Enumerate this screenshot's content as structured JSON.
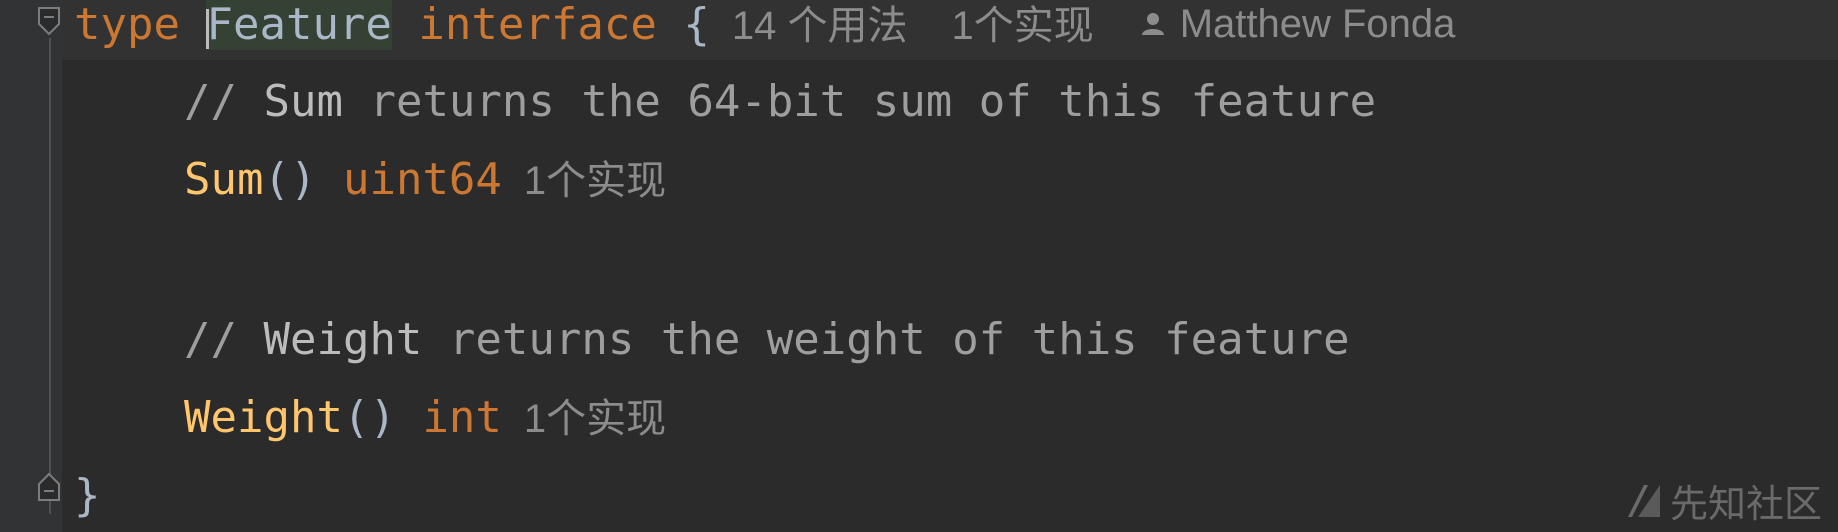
{
  "code": {
    "line1": {
      "kw_type": "type",
      "ident_first": "F",
      "ident_rest": "eature",
      "kw_interface": "interface",
      "brace_open": "{",
      "usages_hint": "14 个用法",
      "impl_hint": "1个实现",
      "author": "Matthew Fonda"
    },
    "line2": {
      "comment_prefix": "// ",
      "comment_word": "Sum",
      "comment_rest": " returns the 64-bit sum of this feature"
    },
    "line3": {
      "method": "Sum",
      "parens": "()",
      "return_type": "uint64",
      "impl_hint": "1个实现"
    },
    "line5": {
      "comment_prefix": "// ",
      "comment_word": "Weight",
      "comment_rest": " returns the weight of this feature"
    },
    "line6": {
      "method": "Weight",
      "parens": "()",
      "return_type": "int",
      "impl_hint": "1个实现"
    },
    "line7": {
      "brace_close": "}"
    }
  },
  "icons": {
    "fold_open": "fold-open-icon",
    "fold_close": "fold-close-icon",
    "author": "person-icon"
  },
  "watermark": {
    "text": "先知社区"
  },
  "colors": {
    "background": "#2b2b2b",
    "keyword": "#cc7832",
    "function": "#ffc66d",
    "comment": "#9e9e9e",
    "hint": "#8c8c8c"
  }
}
